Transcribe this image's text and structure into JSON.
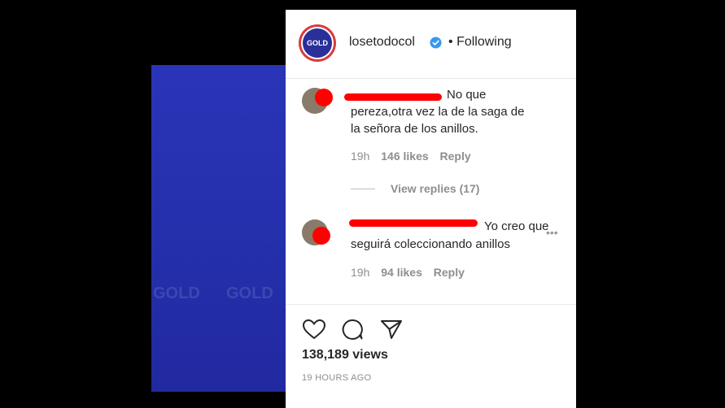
{
  "media": {
    "watermark": "GOLD"
  },
  "header": {
    "avatar_text": "GOLD",
    "username": "losetodocol",
    "separator": "•",
    "follow_status": "Following"
  },
  "comments": [
    {
      "text_line1": "No que",
      "text_line2": "pereza,otra vez la de la saga de",
      "text_line3": "la señora de los anillos.",
      "time": "19h",
      "likes": "146 likes",
      "reply": "Reply"
    },
    {
      "text_line1": "Yo creo que",
      "text_line2": "seguirá coleccionando anillos",
      "time": "19h",
      "likes": "94 likes",
      "reply": "Reply"
    }
  ],
  "view_replies": "View replies (17)",
  "more_menu": "•••",
  "actions": {
    "icons": [
      "heart-icon",
      "comment-icon",
      "share-icon"
    ]
  },
  "stats": {
    "views": "138,189 views",
    "timestamp": "19 HOURS AGO"
  },
  "colors": {
    "media": "#2530ad",
    "redaction": "#ff0000",
    "verified": "#3897f0"
  }
}
